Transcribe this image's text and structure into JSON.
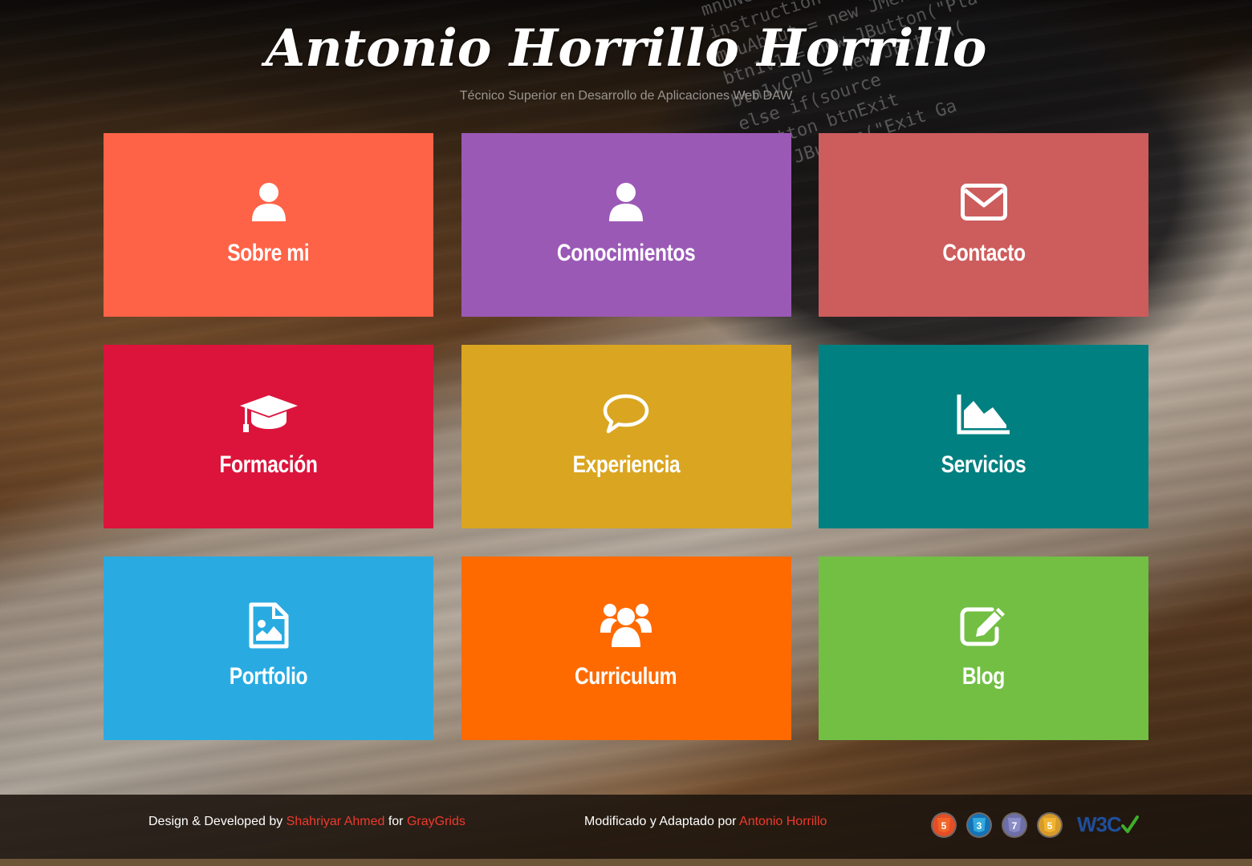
{
  "header": {
    "title": "Antonio Horrillo Horrillo",
    "subtitle": "Técnico Superior en Desarrollo de Aplicaciones Web DAW"
  },
  "screen_code": "mnuNewGame = new JMenuBar()\ninstruction = new JMenuItem(\nmnuAbout = new JMenuItem(\nbtn1v1 = new JButton(\"Pla\nbtn1vCPU = new JButton(\nelse if(source\nJButton btnExit\nnew JButton(\"Exit Ga",
  "tiles": [
    {
      "label": "Sobre mi",
      "icon": "user-icon",
      "color": "#FF6347"
    },
    {
      "label": "Conocimientos",
      "icon": "user-icon",
      "color": "#9B59B6"
    },
    {
      "label": "Contacto",
      "icon": "envelope-icon",
      "color": "#CD5C5C"
    },
    {
      "label": "Formación",
      "icon": "graduation-cap-icon",
      "color": "#DC143C"
    },
    {
      "label": "Experiencia",
      "icon": "speech-bubble-icon",
      "color": "#DAA520"
    },
    {
      "label": "Servicios",
      "icon": "area-chart-icon",
      "color": "#008080"
    },
    {
      "label": "Portfolio",
      "icon": "image-file-icon",
      "color": "#29ABE2"
    },
    {
      "label": "Curriculum",
      "icon": "users-icon",
      "color": "#FF6A00"
    },
    {
      "label": "Blog",
      "icon": "edit-icon",
      "color": "#72BF44"
    }
  ],
  "footer": {
    "left_prefix": "Design & Developed by ",
    "left_author": "Shahriyar Ahmed",
    "left_for": " for ",
    "left_company": "GrayGrids",
    "mid_prefix": "Modificado y Adaptado por ",
    "mid_author": "Antonio Horrillo",
    "badges": [
      "html5-badge-icon",
      "css3-badge-icon",
      "number-7-badge-icon",
      "js-badge-icon"
    ],
    "badge_labels": [
      "5",
      "3",
      "7",
      "5"
    ],
    "w3c_label": "W3C",
    "link_color": "#EE3A2C"
  }
}
